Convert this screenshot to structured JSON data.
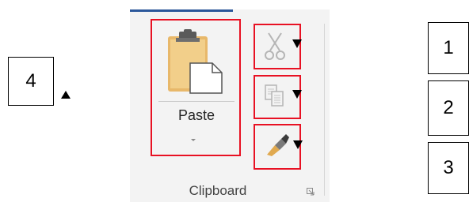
{
  "ribbon": {
    "paste_label": "Paste",
    "group_label": "Clipboard",
    "accent_color": "#2b579a",
    "highlight_color": "#e81123",
    "buttons": {
      "paste": {
        "icon": "clipboard-icon"
      },
      "cut": {
        "icon": "scissors-icon"
      },
      "copy": {
        "icon": "copy-icon"
      },
      "format_painter": {
        "icon": "paintbrush-icon"
      },
      "launcher": {
        "icon": "dialog-launcher-icon"
      }
    }
  },
  "callouts": {
    "left": {
      "number": "4"
    },
    "right": [
      {
        "number": "1"
      },
      {
        "number": "2"
      },
      {
        "number": "3"
      }
    ]
  }
}
